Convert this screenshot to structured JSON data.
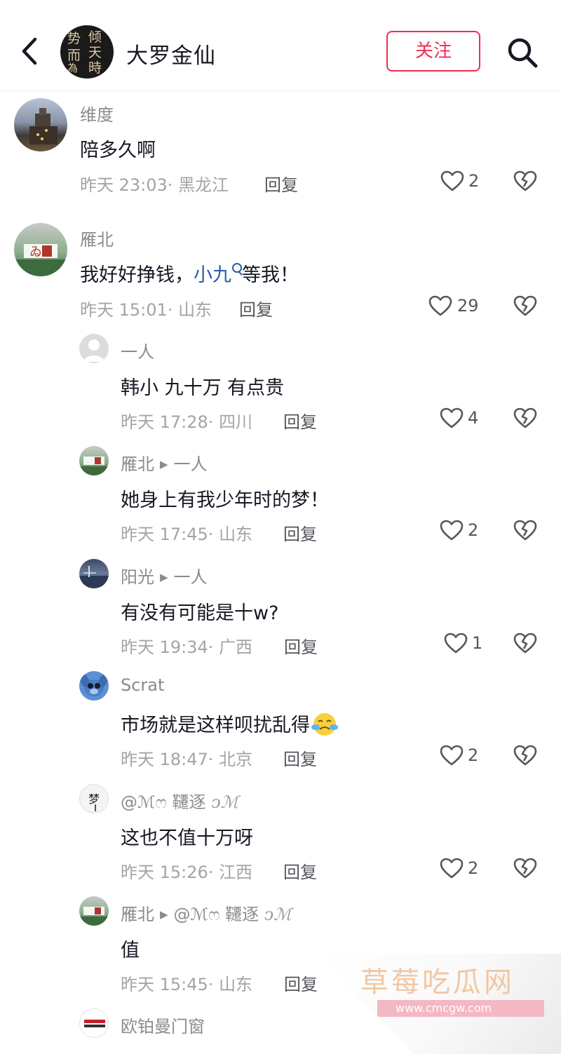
{
  "header": {
    "author_name": "大罗金仙",
    "follow_label": "关注",
    "logo_chars": [
      "势",
      "倾",
      "天",
      "而",
      "為",
      "時"
    ]
  },
  "comments": [
    {
      "user": "维度",
      "text": "陪多久啊",
      "time": "昨天 23:03",
      "location": "黑龙江",
      "reply_label": "回复",
      "likes": "2"
    },
    {
      "user": "雁北",
      "text_before": "我好好挣钱，",
      "mention": "小九",
      "text_after": "等我！",
      "time": "昨天 15:01",
      "location": "山东",
      "reply_label": "回复",
      "likes": "29"
    },
    {
      "user": "一人",
      "text": "韩小 九十万 有点贵",
      "time": "昨天 17:28",
      "location": "四川",
      "reply_label": "回复",
      "likes": "4"
    },
    {
      "user": "雁北",
      "reply_to": "一人",
      "text": "她身上有我少年时的梦！",
      "time": "昨天 17:45",
      "location": "山东",
      "reply_label": "回复",
      "likes": "2"
    },
    {
      "user": "阳光",
      "reply_to": "一人",
      "text": "有没有可能是十w?",
      "time": "昨天 19:34",
      "location": "广西",
      "reply_label": "回复",
      "likes": "1"
    },
    {
      "user": "Scrat",
      "text": "市场就是这样呗扰乱得",
      "time": "昨天 18:47",
      "location": "北京",
      "reply_label": "回复",
      "likes": "2",
      "emoji": "crying-face"
    },
    {
      "user": "@ℳෆ 韆逐",
      "user_sig": "ℳ",
      "text": "这也不值十万呀",
      "time": "昨天 15:26",
      "location": "江西",
      "reply_label": "回复",
      "likes": "2"
    },
    {
      "user": "雁北",
      "reply_to": "@ℳෆ 韆逐",
      "reply_to_sig": "ℳ",
      "text": "值",
      "time": "昨天 15:45",
      "location": "山东",
      "reply_label": "回复"
    },
    {
      "user": "欧铂曼门窗"
    }
  ],
  "watermark": {
    "title": "草莓吃瓜网",
    "url": "www.cmcgw.com"
  },
  "colors": {
    "accent": "#f02c55",
    "mention": "#2b5aa6",
    "meta": "#a3a4a8"
  }
}
